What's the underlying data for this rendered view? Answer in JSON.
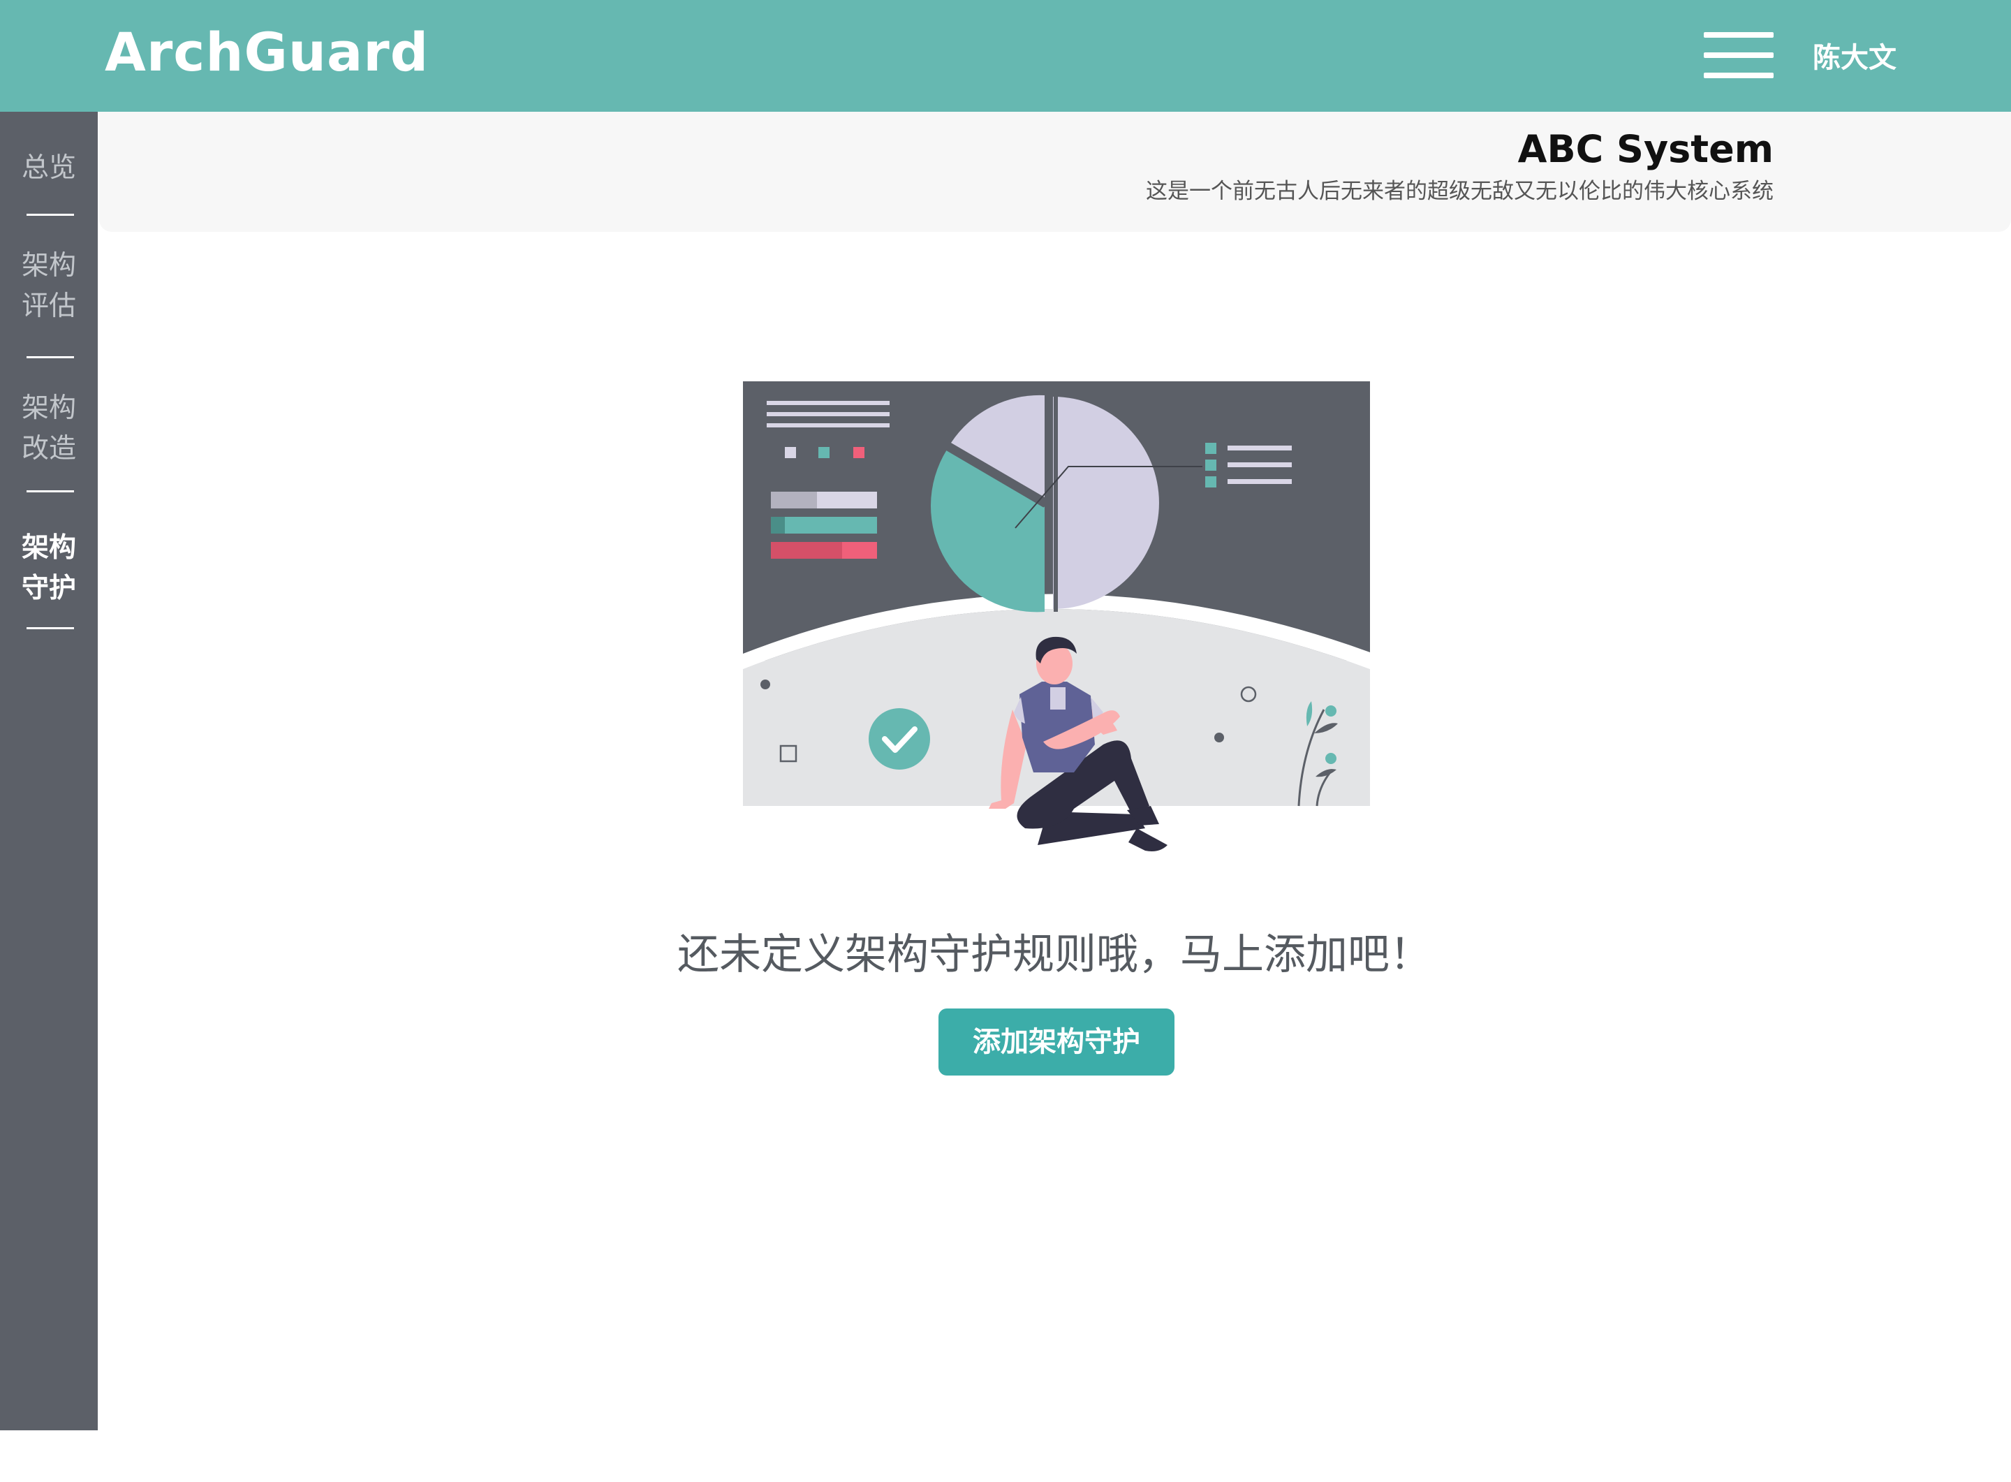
{
  "header": {
    "logo": "ArchGuard",
    "user_name": "陈大文"
  },
  "sidebar": {
    "items": [
      {
        "label": "总览",
        "active": false
      },
      {
        "label": "架构评估",
        "active": false
      },
      {
        "label": "架构改造",
        "active": false
      },
      {
        "label": "架构守护",
        "active": true
      }
    ],
    "settings_icon": "gear-icon"
  },
  "system": {
    "title": "ABC System",
    "description": "这是一个前无古人后无来者的超级无敌又无以伦比的伟大核心系统"
  },
  "empty_state": {
    "message": "还未定义架构守护规则哦，马上添加吧！",
    "button_label": "添加架构守护"
  },
  "colors": {
    "header": "#66b8b1",
    "sidebar": "#5c6068",
    "accent": "#3cada9",
    "highlight": "#f0607a"
  }
}
